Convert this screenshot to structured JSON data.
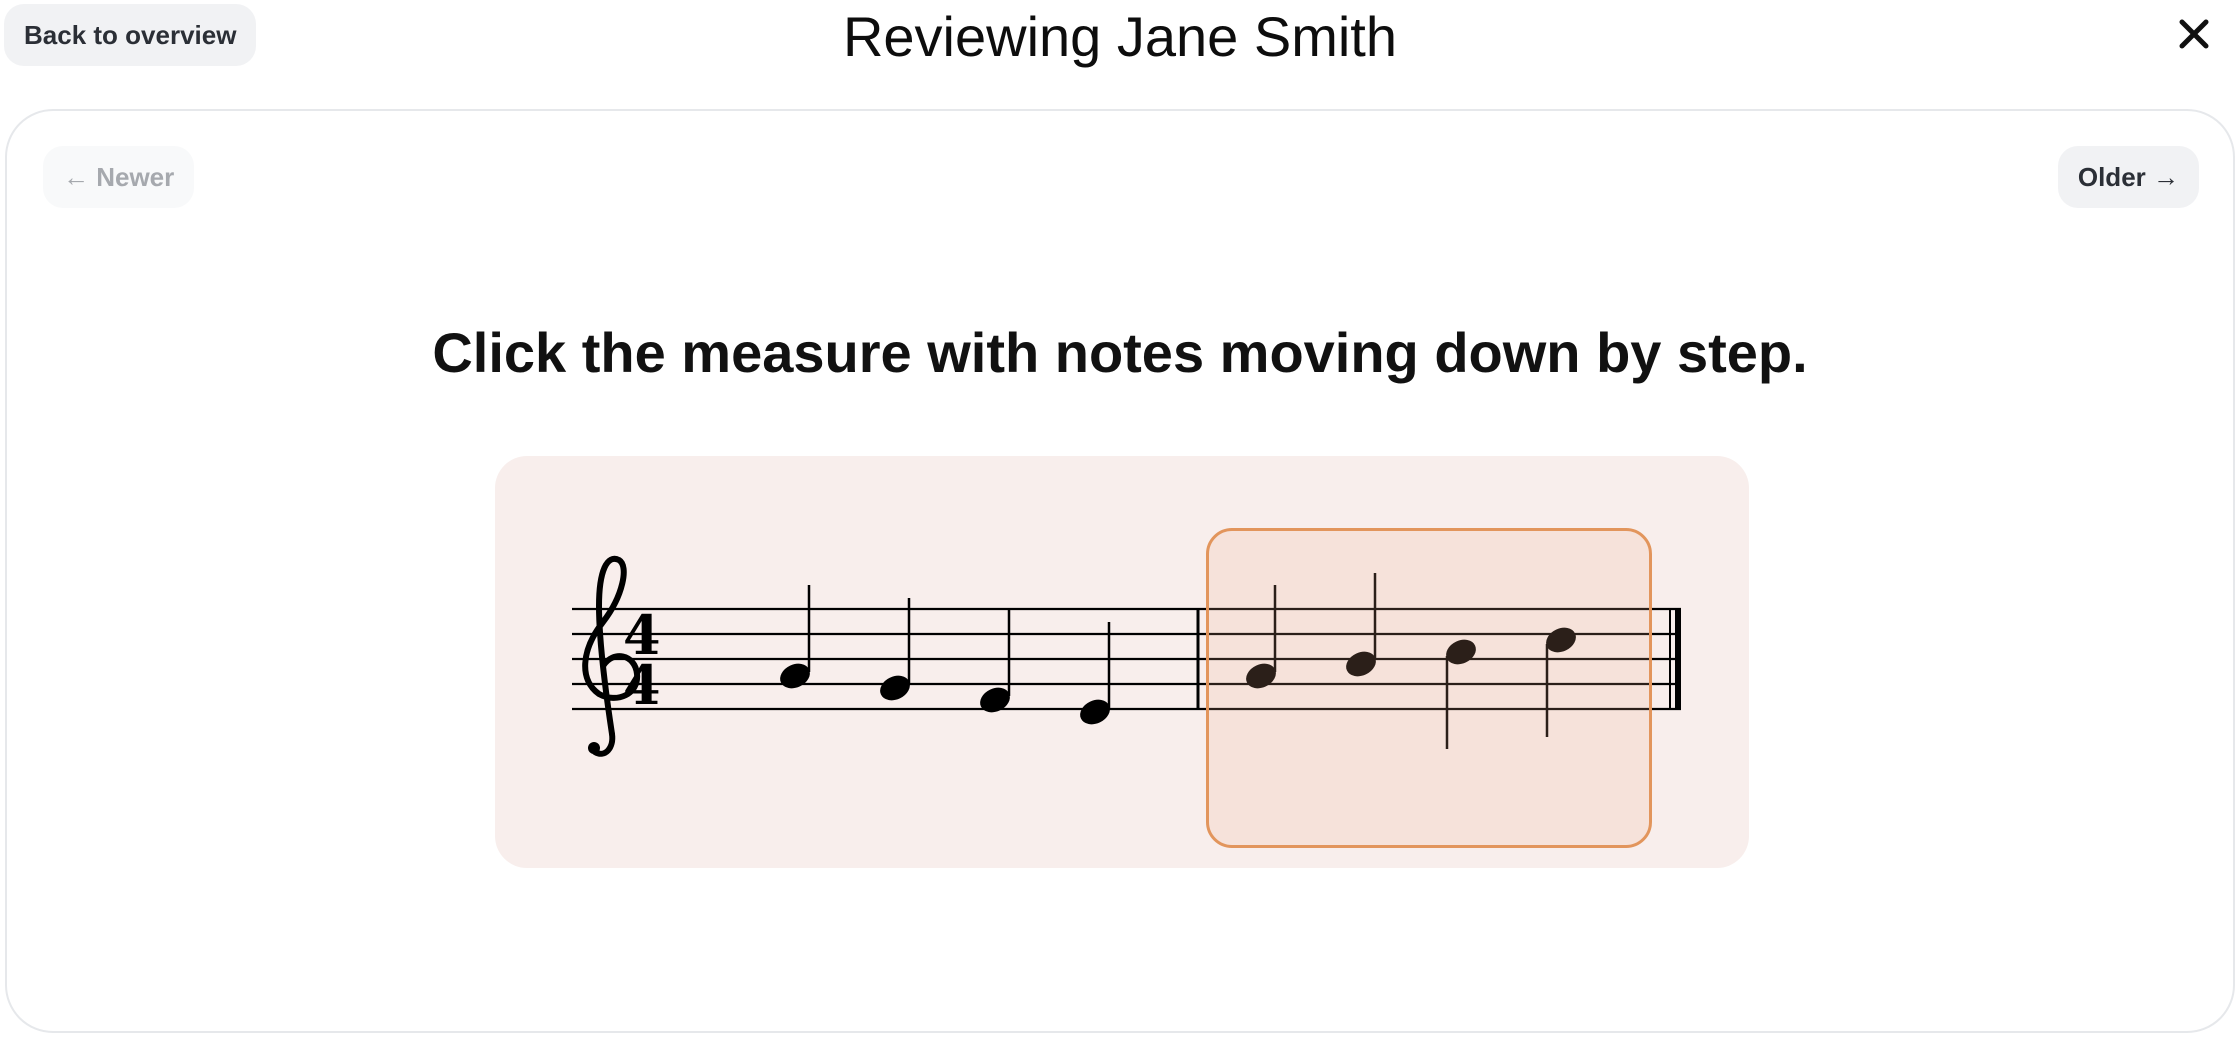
{
  "header": {
    "back_label": "Back to overview",
    "title": "Reviewing Jane Smith",
    "close_icon": "close-icon"
  },
  "navigation": {
    "newer_label": "← Newer",
    "newer_enabled": false,
    "older_label": "Older →",
    "older_enabled": true
  },
  "question": {
    "prompt": "Click the measure with notes moving down by step."
  },
  "score": {
    "clef": "treble",
    "time_signature": {
      "top": "4",
      "bottom": "4"
    },
    "measures": [
      {
        "notes": [
          "G4",
          "F4",
          "E4",
          "D4"
        ],
        "selected": false
      },
      {
        "notes": [
          "G4",
          "A4",
          "B4",
          "C5"
        ],
        "selected": true
      }
    ]
  },
  "colors": {
    "panel_background": "#f8eeec",
    "selection_border": "#e2955c",
    "button_background": "#f1f2f4",
    "disabled_text": "#a6a9ae"
  }
}
